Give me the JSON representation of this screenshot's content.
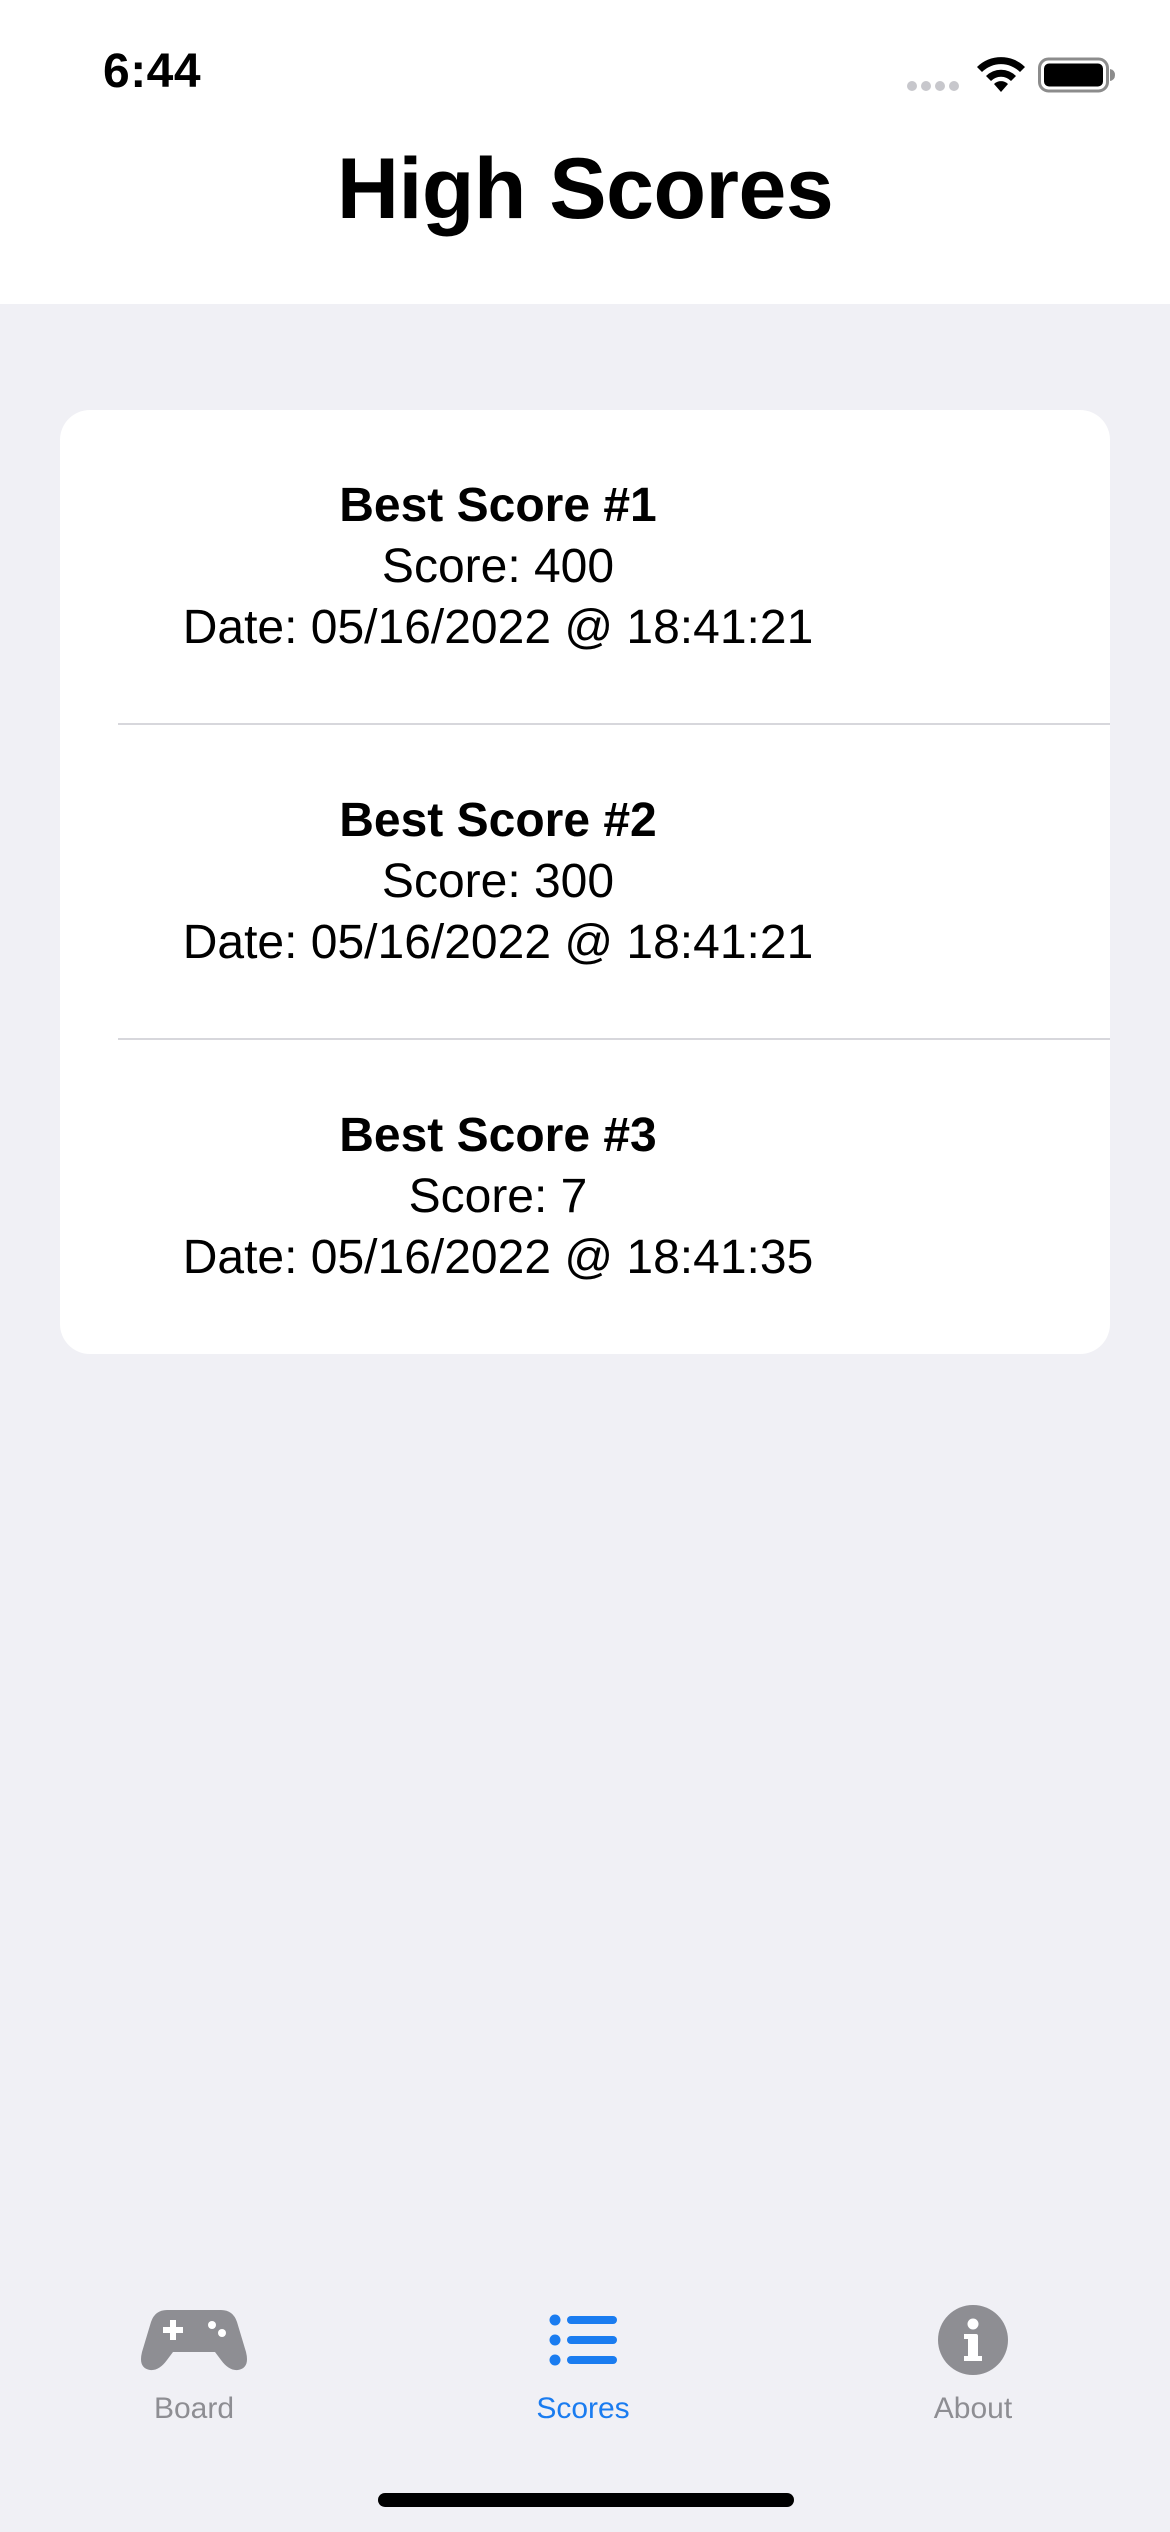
{
  "status_bar": {
    "time": "6:44"
  },
  "header": {
    "title": "High Scores"
  },
  "scores": [
    {
      "title": "Best Score #1",
      "score": "Score: 400",
      "date": "Date: 05/16/2022 @ 18:41:21"
    },
    {
      "title": "Best Score #2",
      "score": "Score: 300",
      "date": "Date: 05/16/2022 @ 18:41:21"
    },
    {
      "title": "Best Score #3",
      "score": "Score: 7",
      "date": "Date: 05/16/2022 @ 18:41:35"
    }
  ],
  "tabbar": {
    "items": [
      {
        "label": "Board",
        "icon": "gamecontroller-icon",
        "selected": false
      },
      {
        "label": "Scores",
        "icon": "list-icon",
        "selected": true
      },
      {
        "label": "About",
        "icon": "info-icon",
        "selected": false
      }
    ]
  },
  "colors": {
    "accent": "#1a7cf0",
    "inactive": "#8e8e93",
    "background": "#f0f0f5",
    "card": "#ffffff"
  }
}
